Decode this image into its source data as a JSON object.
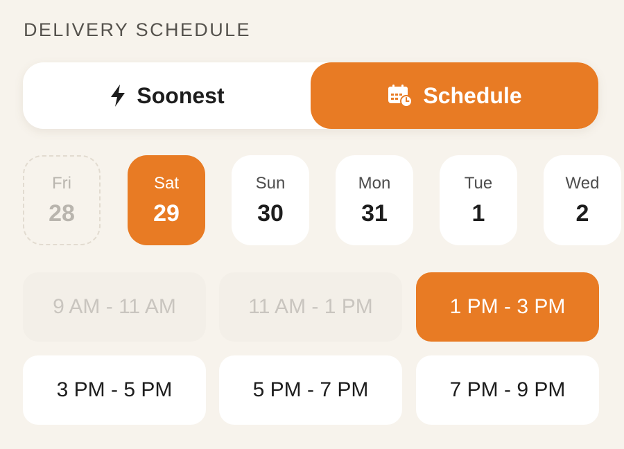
{
  "header": {
    "title": "DELIVERY SCHEDULE"
  },
  "mode_toggle": {
    "options": [
      {
        "label": "Soonest",
        "icon": "lightning-bolt-icon",
        "selected": false
      },
      {
        "label": "Schedule",
        "icon": "calendar-clock-icon",
        "selected": true
      }
    ]
  },
  "days": [
    {
      "dow": "Fri",
      "num": "28",
      "state": "disabled"
    },
    {
      "dow": "Sat",
      "num": "29",
      "state": "selected"
    },
    {
      "dow": "Sun",
      "num": "30",
      "state": "available"
    },
    {
      "dow": "Mon",
      "num": "31",
      "state": "available"
    },
    {
      "dow": "Tue",
      "num": "1",
      "state": "available"
    },
    {
      "dow": "Wed",
      "num": "2",
      "state": "available"
    }
  ],
  "time_slots": [
    {
      "label": "9 AM - 11 AM",
      "state": "disabled"
    },
    {
      "label": "11 AM - 1 PM",
      "state": "disabled"
    },
    {
      "label": "1 PM - 3 PM",
      "state": "selected"
    },
    {
      "label": "3 PM - 5 PM",
      "state": "available"
    },
    {
      "label": "5 PM - 7 PM",
      "state": "available"
    },
    {
      "label": "7 PM - 9 PM",
      "state": "available"
    }
  ],
  "colors": {
    "accent": "#e87b24",
    "background": "#f7f3ec",
    "card": "#ffffff",
    "muted_text": "#b9b5ae"
  }
}
